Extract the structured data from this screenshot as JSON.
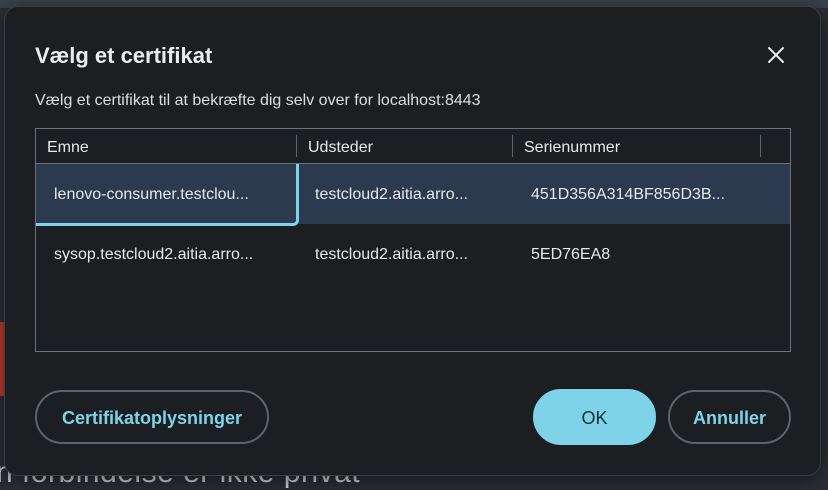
{
  "background": {
    "partial_text": "n forbindelse er ikke privat"
  },
  "dialog": {
    "title": "Vælg et certifikat",
    "description": "Vælg et certifikat til at bekræfte dig selv over for localhost:8443",
    "close_icon": "close-icon"
  },
  "table": {
    "columns": [
      "Emne",
      "Udsteder",
      "Serienummer"
    ],
    "rows": [
      {
        "subject": "lenovo-consumer.testclou...",
        "issuer": "testcloud2.aitia.arro...",
        "serial": "451D356A314BF856D3B...",
        "selected": true
      },
      {
        "subject": "sysop.testcloud2.aitia.arro...",
        "issuer": "testcloud2.aitia.arro...",
        "serial": "5ED76EA8",
        "selected": false
      }
    ]
  },
  "buttons": {
    "details": "Certifikatoplysninger",
    "ok": "OK",
    "cancel": "Annuller"
  },
  "colors": {
    "accent": "#7fd3e8",
    "selected_row": "#2c3a4f",
    "dialog_bg": "#1b1f22"
  }
}
